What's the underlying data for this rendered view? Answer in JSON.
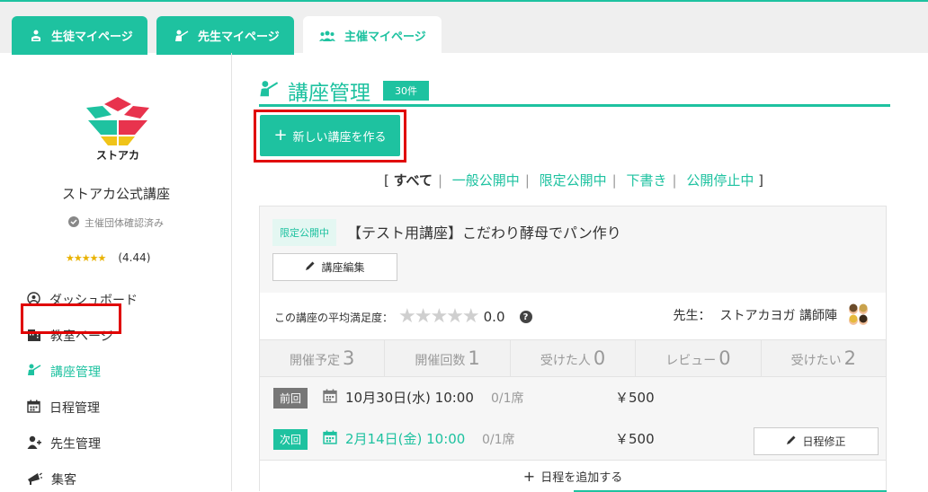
{
  "tabs": [
    {
      "label": "生徒マイページ",
      "icon": "student-icon"
    },
    {
      "label": "先生マイページ",
      "icon": "teacher-icon"
    },
    {
      "label": "主催マイページ",
      "icon": "group-icon"
    }
  ],
  "sidebar": {
    "logo_text": "ストアカ",
    "org_name": "ストアカ公式講座",
    "verified": "主催団体確認済み",
    "stars": "★★★★★",
    "rating": "(4.44)",
    "items": [
      {
        "label": "ダッシュボード",
        "icon": "dashboard-icon"
      },
      {
        "label": "教室ページ",
        "icon": "building-icon"
      },
      {
        "label": "講座管理",
        "icon": "teacher-icon"
      },
      {
        "label": "日程管理",
        "icon": "calendar-icon"
      },
      {
        "label": "先生管理",
        "icon": "user-plus-icon"
      },
      {
        "label": "集客",
        "icon": "megaphone-icon"
      }
    ]
  },
  "main": {
    "title": "講座管理",
    "count": "30件",
    "new_button": "新しい講座を作る",
    "filters": {
      "open": "[",
      "close": "]",
      "items": [
        "すべて",
        "一般公開中",
        "限定公開中",
        "下書き",
        "公開停止中"
      ]
    }
  },
  "course": {
    "status": "限定公開中",
    "title": "【テスト用講座】こだわり酵母でパン作り",
    "edit_label": "講座編集",
    "satisfaction_label": "この講座の平均満足度：",
    "satisfaction_stars": "★★★★★",
    "satisfaction_score": "0.0",
    "help": "?",
    "teacher_label": "先生：",
    "teacher_name": "ストアカヨガ 講師陣",
    "stats": [
      {
        "label": "開催予定",
        "value": "3"
      },
      {
        "label": "開催回数",
        "value": "1"
      },
      {
        "label": "受けた人",
        "value": "0"
      },
      {
        "label": "レビュー",
        "value": "0"
      },
      {
        "label": "受けたい",
        "value": "2"
      }
    ],
    "schedules": [
      {
        "badge": "前回",
        "date": "10月30日(水) 10:00",
        "seats": "0/1席",
        "price": "￥500"
      },
      {
        "badge": "次回",
        "date": "2月14日(金) 10:00",
        "seats": "0/1席",
        "price": "￥500",
        "fix_label": "日程修正"
      }
    ],
    "add_schedule": "日程を追加する"
  },
  "colors": {
    "accent": "#1ec2a0",
    "highlight": "#e00000",
    "star": "#e9b200"
  }
}
